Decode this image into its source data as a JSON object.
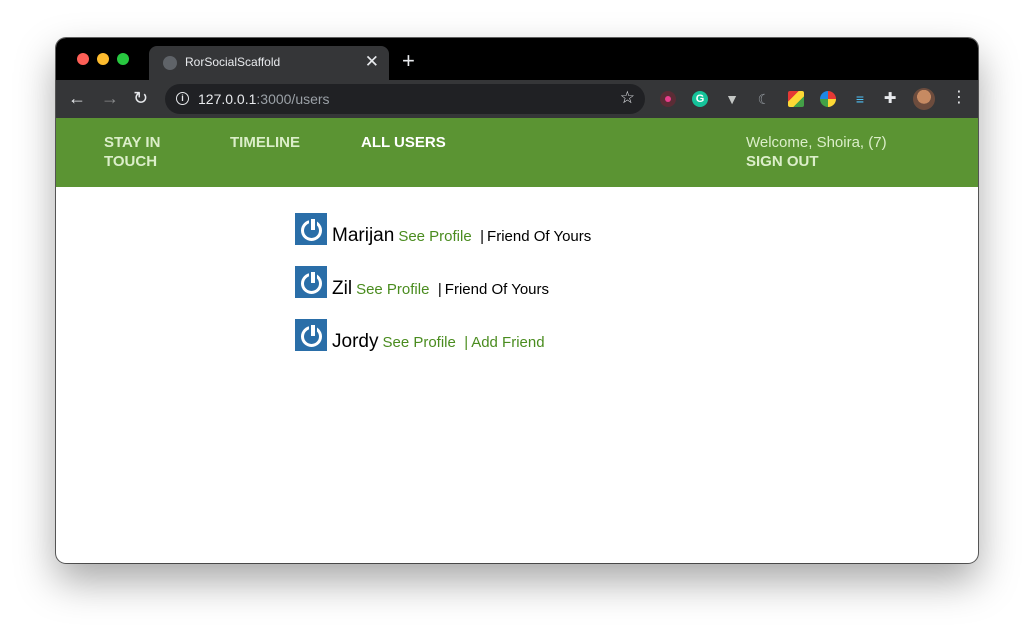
{
  "browser": {
    "tab_title": "RorSocialScaffold",
    "tab_close": "✕",
    "new_tab": "+",
    "url_host": "127.0.0.1",
    "url_path": ":3000/users",
    "extensions": [
      "screencastify-icon",
      "grammarly-icon",
      "vue-devtools-icon",
      "react-icon",
      "ext-colorful-icon",
      "ext-circle-icon",
      "filter-icon",
      "puzzle-icon"
    ]
  },
  "header": {
    "brand": "STAY IN TOUCH",
    "timeline": "TIMELINE",
    "all_users": "ALL USERS",
    "welcome": "Welcome, Shoira, (7)",
    "sign_out": "SIGN OUT"
  },
  "users": [
    {
      "name": "Marijan",
      "see_profile": "See Profile",
      "separator": "|",
      "status": "Friend Of Yours"
    },
    {
      "name": "Zil",
      "see_profile": "See Profile",
      "separator": "|",
      "status": "Friend Of Yours"
    },
    {
      "name": "Jordy",
      "see_profile": "See Profile",
      "separator": "|",
      "status": "Add Friend"
    }
  ],
  "colors": {
    "header_green": "#5b9433",
    "link_green": "#4a8c1f",
    "avatar_blue": "#2a6ea8"
  }
}
